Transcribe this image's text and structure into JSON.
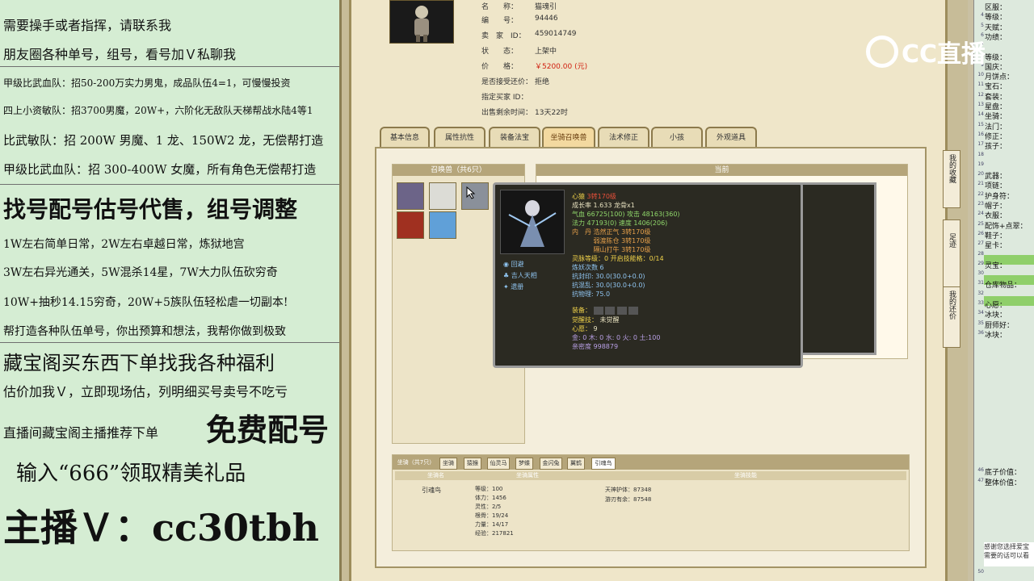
{
  "left_panel": {
    "lines": [
      "需要操手或者指挥，请联系我",
      "朋友圈各种单号，组号，看号加Ｖ私聊我",
      "甲级比武血队：招50-200万实力男鬼，成品队伍4=1，可慢慢投资",
      "四上小资敏队：招3700男魔，20W+，六阶化无敌队天梯帮战水陆4等1",
      "比武敏队：招 200W 男魔、1 龙、150W2 龙，无偿帮打造",
      "甲级比武血队：招 300-400W 女魔，所有角色无偿帮打造",
      "找号配号估号代售，组号调整",
      "1W左右简单日常，2W左右卓越日常，炼狱地宫",
      "3W左右异光通关，5W混杀14星，7W大力队伍砍穷奇",
      "10W+抽秒14.15穷奇，20W+5族队伍轻松虐一切副本!",
      "帮打造各种队伍单号，你出预算和想法，我帮你做到极致",
      "藏宝阁买东西下单找我各种福利",
      "估价加我Ｖ，立即现场估，列明细买号卖号不吃亏",
      "直播间藏宝阁主播推荐下单",
      "免费配号",
      "输入“666”领取精美礼品",
      "主播Ｖ：cc30tbh"
    ]
  },
  "item_info": {
    "rows": [
      {
        "label": "名　　称：",
        "value": "猫魂引"
      },
      {
        "label": "编　　号：",
        "value": "94446"
      },
      {
        "label": "卖　家　ID：",
        "value": "459014749"
      },
      {
        "label": "状　　态：",
        "value": "上架中"
      },
      {
        "label": "价　　格：",
        "value": "￥5200.00 (元)"
      },
      {
        "label": "是否接受还价：",
        "value": "拒绝"
      },
      {
        "label": "指定买家 ID：",
        "value": ""
      },
      {
        "label": "出售剩余时间：",
        "value": "13天22时"
      }
    ]
  },
  "tabs": [
    "基本信息",
    "属性抗性",
    "装备法宝",
    "坐骑召唤兽",
    "法术修正",
    "小孩",
    "外观道具"
  ],
  "active_tab": "坐骑召唤兽",
  "pets_panel": {
    "header": "召唤兽（共6只）"
  },
  "detail_panel": {
    "header": "当前"
  },
  "popup": {
    "name_label": "心猿",
    "name_value": "3转170级",
    "lines": [
      {
        "text": "成长率 1.633  龙骨x1",
        "cls": ""
      },
      {
        "text": "气血 66725(100) 攻击 48163(360)",
        "cls": "grn"
      },
      {
        "text": "法力 47193(0) 速度 1406(206)",
        "cls": "grn"
      },
      {
        "text": "内　丹 浩然正气 3转170级",
        "cls": "org"
      },
      {
        "text": "　　　 弱渡陈仓 3转170级",
        "cls": "org"
      },
      {
        "text": "　　　 隔山打牛 3转170级",
        "cls": "org"
      },
      {
        "text": "灵脉等级：0 开启技能格：0/14",
        "cls": "yel"
      },
      {
        "text": "炼妖次数 6",
        "cls": "blu"
      },
      {
        "text": "抗封印: 30.0(30.0+0.0)",
        "cls": "blu"
      },
      {
        "text": "抗混乱: 30.0(30.0+0.0)",
        "cls": "blu"
      },
      {
        "text": "抗物理: 75.0",
        "cls": "blu"
      }
    ],
    "equip_label": "装备：",
    "awaken_label": "觉醒技：",
    "awaken_value": "未觉醒",
    "heart_label": "心愿：",
    "heart_value": "9",
    "elements": "金: 0 木: 0 水: 0 火: 0 土:100",
    "intimacy": "亲密度 998879",
    "skills": [
      "回避",
      "吉人天相",
      "遗册"
    ]
  },
  "mounts": {
    "header": "坐骑（共7只）",
    "tabs": [
      "坐骑",
      "猿猴",
      "仙灵马",
      "梦蝶",
      "金闪兔",
      "翼鹤",
      "引魂鸟"
    ],
    "col_headers": [
      "坐骑名",
      "坐骑属性",
      "坐骑技能"
    ],
    "name": "引魂鸟",
    "stats": [
      "等级：100",
      "体力：1456",
      "灵性：2/5",
      "根骨：19/24",
      "力量：14/17",
      "经验：217821"
    ],
    "skills": [
      "天神护体：87348",
      "游刃有余：87548"
    ]
  },
  "side_buttons": [
    "我的收藏",
    "足迹",
    "我的还价"
  ],
  "right_panel": {
    "labels": [
      {
        "num": "",
        "text": "区服："
      },
      {
        "num": "4",
        "text": "等级："
      },
      {
        "num": "5",
        "text": "天赋："
      },
      {
        "num": "6",
        "text": "功绩："
      },
      {
        "num": "7",
        "text": ""
      },
      {
        "num": "8",
        "text": "等级："
      },
      {
        "num": "9",
        "text": "国庆："
      },
      {
        "num": "10",
        "text": "月饼点："
      },
      {
        "num": "11",
        "text": "宝石："
      },
      {
        "num": "12",
        "text": "套装："
      },
      {
        "num": "13",
        "text": "星盘："
      },
      {
        "num": "14",
        "text": "坐骑："
      },
      {
        "num": "15",
        "text": "法门："
      },
      {
        "num": "16",
        "text": "修正："
      },
      {
        "num": "17",
        "text": "孩子："
      },
      {
        "num": "18",
        "text": ""
      },
      {
        "num": "19",
        "text": ""
      },
      {
        "num": "20",
        "text": "武器："
      },
      {
        "num": "21",
        "text": "项链："
      },
      {
        "num": "22",
        "text": "护身符："
      },
      {
        "num": "23",
        "text": "帽子："
      },
      {
        "num": "24",
        "text": "衣服："
      },
      {
        "num": "25",
        "text": "配饰+点翠："
      },
      {
        "num": "26",
        "text": "鞋子："
      },
      {
        "num": "27",
        "text": "星卡："
      },
      {
        "num": "28",
        "text": ""
      },
      {
        "num": "29",
        "text": "灵宝："
      },
      {
        "num": "30",
        "text": ""
      },
      {
        "num": "31",
        "text": "仓库物品："
      },
      {
        "num": "32",
        "text": ""
      },
      {
        "num": "33",
        "text": "心愿："
      },
      {
        "num": "34",
        "text": "冰块："
      },
      {
        "num": "35",
        "text": "厨师好："
      },
      {
        "num": "36",
        "text": "冰块："
      }
    ],
    "bottom_labels": [
      {
        "num": "46",
        "text": "底子价值："
      },
      {
        "num": "47",
        "text": "整体价值："
      }
    ],
    "footer_lines": [
      "感谢您选择爱宝",
      "需要的话可以看"
    ],
    "footer_num": "50"
  },
  "logo": {
    "text": "CC直播"
  }
}
